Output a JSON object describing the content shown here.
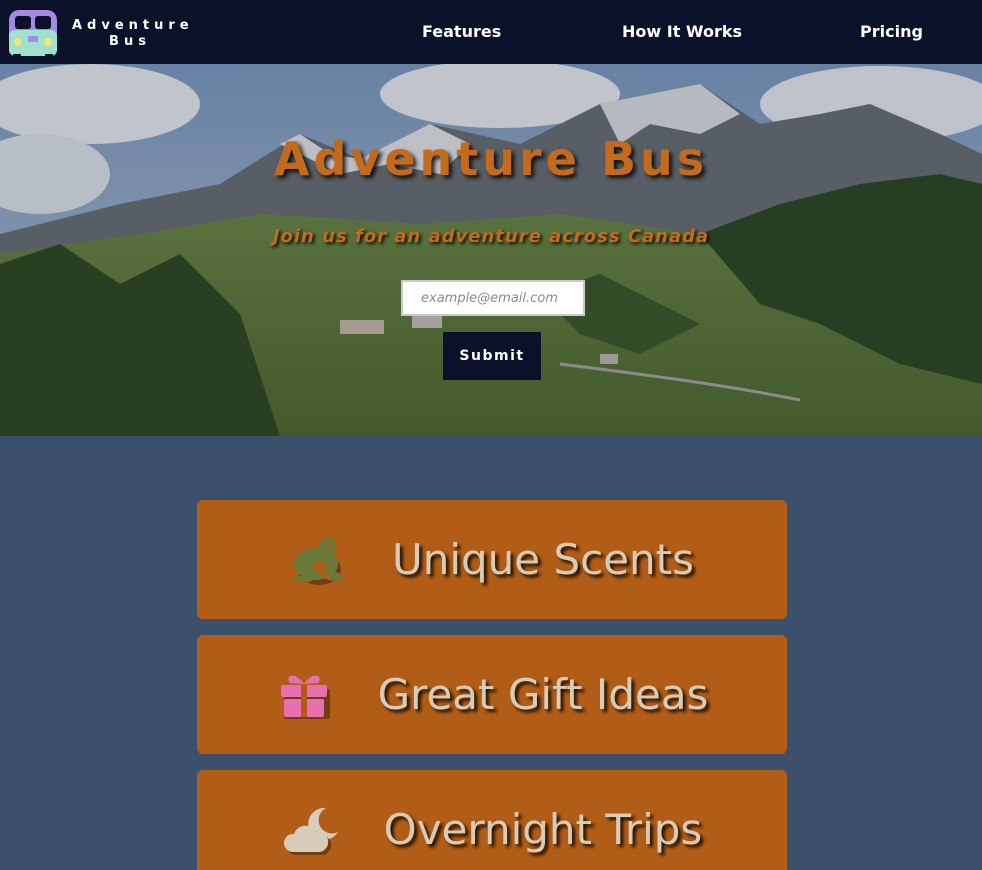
{
  "nav": {
    "brand_line1": "Adventure",
    "brand_line2": "Bus",
    "links": [
      {
        "label": "Features"
      },
      {
        "label": "How It Works"
      },
      {
        "label": "Pricing"
      }
    ]
  },
  "hero": {
    "title": "Adventure Bus",
    "subtitle": "Join us for an adventure across Canada",
    "email_placeholder": "example@email.com",
    "submit_label": "Submit"
  },
  "features": [
    {
      "label": "Unique Scents",
      "icon": "frog-icon",
      "icon_color": "#6b7a3a"
    },
    {
      "label": "Great Gift Ideas",
      "icon": "gift-icon",
      "icon_color": "#e86fb0"
    },
    {
      "label": "Overnight Trips",
      "icon": "cloud-moon-icon",
      "icon_color": "#d8cbb7"
    }
  ],
  "colors": {
    "nav_bg": "#0a1129",
    "page_bg": "#3b516b",
    "accent": "#c46a1c",
    "card_bg": "#b25d17",
    "card_text": "#d8cbb7"
  }
}
